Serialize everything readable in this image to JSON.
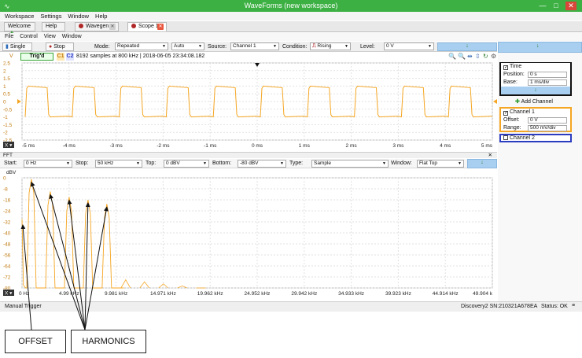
{
  "window": {
    "title": "WaveForms  (new workspace)",
    "colors": {
      "titlebar": "#3cb043",
      "trace": "#f5a623",
      "accent_blue": "#a9cff0"
    }
  },
  "menu": [
    "Workspace",
    "Settings",
    "Window",
    "Help"
  ],
  "tabs": [
    {
      "label": "Welcome",
      "icon": "plus-icon"
    },
    {
      "label": "Help",
      "icon": ""
    },
    {
      "label": "Wavegen 1",
      "icon": "wavegen-icon"
    },
    {
      "label": "Scope 1",
      "icon": "scope-icon"
    }
  ],
  "submenu": [
    "File",
    "Control",
    "View",
    "Window"
  ],
  "toolbar": {
    "single": "Single",
    "stop": "Stop",
    "mode_label": "Mode:",
    "mode_value": "Repeated",
    "auto_value": "Auto",
    "source_label": "Source:",
    "source_value": "Channel 1",
    "condition_label": "Condition:",
    "condition_value": "Rising",
    "level_label": "Level:",
    "level_value": "0 V"
  },
  "scope_status": {
    "trig": "Trig'd",
    "c1": "C1",
    "c2": "C2",
    "info": "8192 samples at 800 kHz | 2018-06-05 23:34:08.182"
  },
  "scope": {
    "y_ticks": [
      "2.5",
      "2",
      "1.5",
      "1",
      "0.5",
      "0",
      "-0.5",
      "-1",
      "-1.5",
      "-2",
      "-2.5"
    ],
    "x_ticks": [
      "-5 ms",
      "-4 ms",
      "-3 ms",
      "-2 ms",
      "-1 ms",
      "0 ms",
      "1 ms",
      "2 ms",
      "3 ms",
      "4 ms",
      "5 ms"
    ],
    "y_label": "V"
  },
  "fft": {
    "header": "FFT",
    "start_label": "Start:",
    "start_value": "0 Hz",
    "stop_label": "Stop:",
    "stop_value": "50 kHz",
    "top_label": "Top:",
    "top_value": "0 dBV",
    "bottom_label": "Bottom:",
    "bottom_value": "-80 dBV",
    "type_label": "Type:",
    "type_value": "Sample",
    "window_label": "Window:",
    "window_value": "Flat Top",
    "y_unit": "dBV",
    "y_ticks": [
      "0",
      "-8",
      "-16",
      "-24",
      "-32",
      "-40",
      "-48",
      "-56",
      "-64",
      "-72",
      "-80"
    ],
    "x_ticks": [
      "0 Hz",
      "4.99 kHz",
      "9.981 kHz",
      "14.971 kHz",
      "19.962 kHz",
      "24.952 kHz",
      "29.942 kHz",
      "34.933 kHz",
      "39.923 kHz",
      "44.914 kHz",
      "49.904 k"
    ],
    "peaks_db": [
      -1,
      -10,
      -14,
      -16,
      -19
    ],
    "peaks_hz": [
      1000,
      3000,
      5000,
      7000,
      9000
    ]
  },
  "side": {
    "time": {
      "title": "Time",
      "position_label": "Position:",
      "position_value": "0 s",
      "base_label": "Base:",
      "base_value": "1 ms/div"
    },
    "add_channel": "Add Channel",
    "ch1": {
      "title": "Channel 1",
      "offset_label": "Offset:",
      "offset_value": "0 V",
      "range_label": "Range:",
      "range_value": "500 mV/div"
    },
    "ch2": {
      "title": "Channel 2"
    }
  },
  "statusbar": {
    "left": "Manual Trigger",
    "device": "Discovery2 SN:210321A678EA",
    "status": "Status: OK"
  },
  "annotations": {
    "offset": "OFFSET",
    "harmonics": "HARMONICS"
  }
}
